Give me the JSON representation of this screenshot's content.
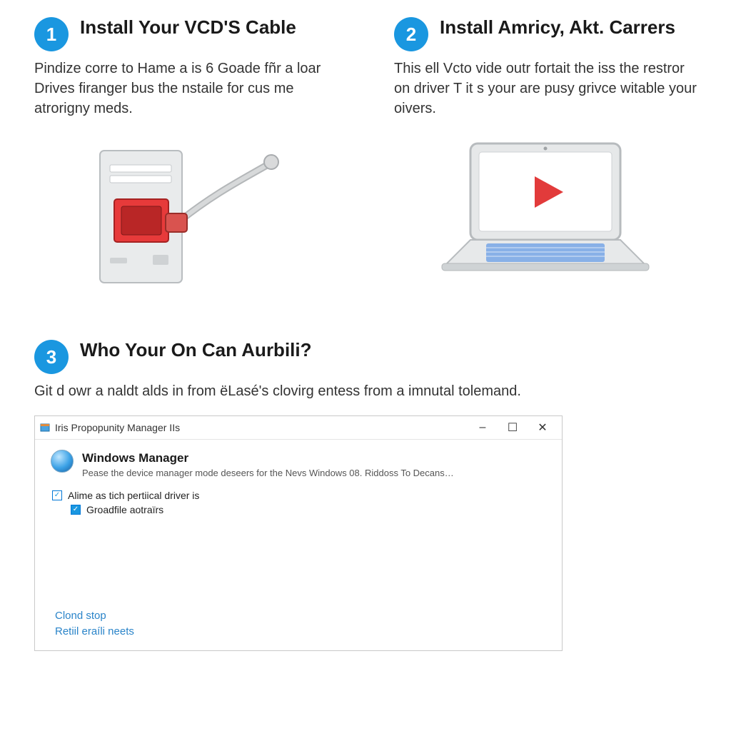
{
  "steps": [
    {
      "number": "1",
      "title": "Install Your VCD'S Cable",
      "desc": "Pindize corre to Hame a is 6 Goade fñr a loar Drives firanger bus the nstaile for cus me atrorigny meds."
    },
    {
      "number": "2",
      "title": "Install Amricy, Akt. Carrers",
      "desc": "This ell Vcto vide outr fortait the iss the restror on driver T it s your are pusy grivce witable your oivers."
    },
    {
      "number": "3",
      "title": "Who Your On Can Aurbili?",
      "desc": "Git d owr a naldt alds in from ëLasé's clovirg entess from a imnutal tolemand."
    }
  ],
  "window": {
    "title": "Iris Propopunity Manager IIs",
    "manager_title": "Windows Manager",
    "manager_sub": "Pease the device manager mode deseers for the Nevs Windows 08. Riddoss To Decans…",
    "item1": "Alime as tich pertiical driver is",
    "item2": "Groadfile aotraïrs",
    "link1": "Clond stop",
    "link2": "Retiil eraíli neets"
  },
  "icons": {
    "play": "play-icon",
    "minimize": "–",
    "maximize": "☐",
    "close": "✕",
    "check": "✓"
  }
}
